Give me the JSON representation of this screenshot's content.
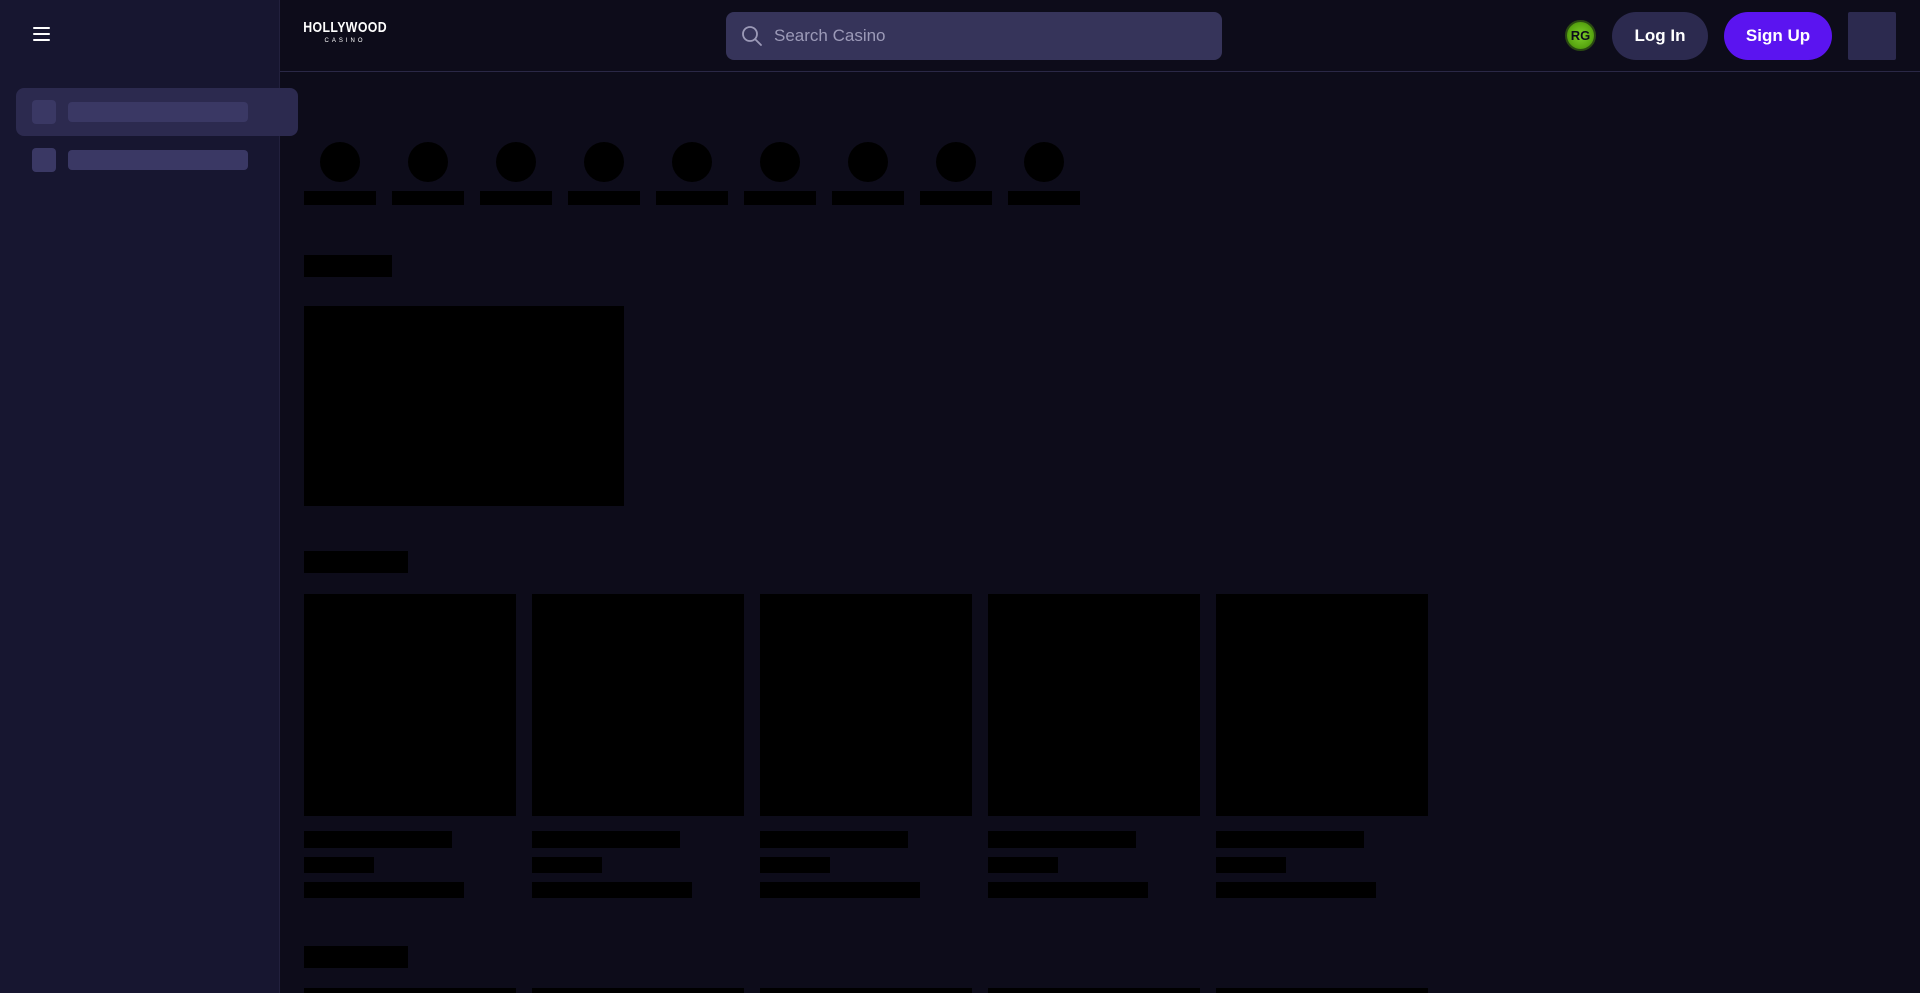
{
  "header": {
    "logo": {
      "line1": "HOLLYWOOD",
      "line2": "CASINO"
    },
    "search": {
      "placeholder": "Search Casino",
      "value": ""
    },
    "rg_badge": "RG",
    "login_label": "Log In",
    "signup_label": "Sign Up"
  },
  "colors": {
    "background": "#0d0c1a",
    "sidebar": "#171630",
    "accent": "#5b14f0",
    "secondary_button": "#2c2a4f",
    "rg_badge": "#5aa812"
  },
  "icons": {
    "menu": "hamburger-icon",
    "search": "search-icon"
  }
}
